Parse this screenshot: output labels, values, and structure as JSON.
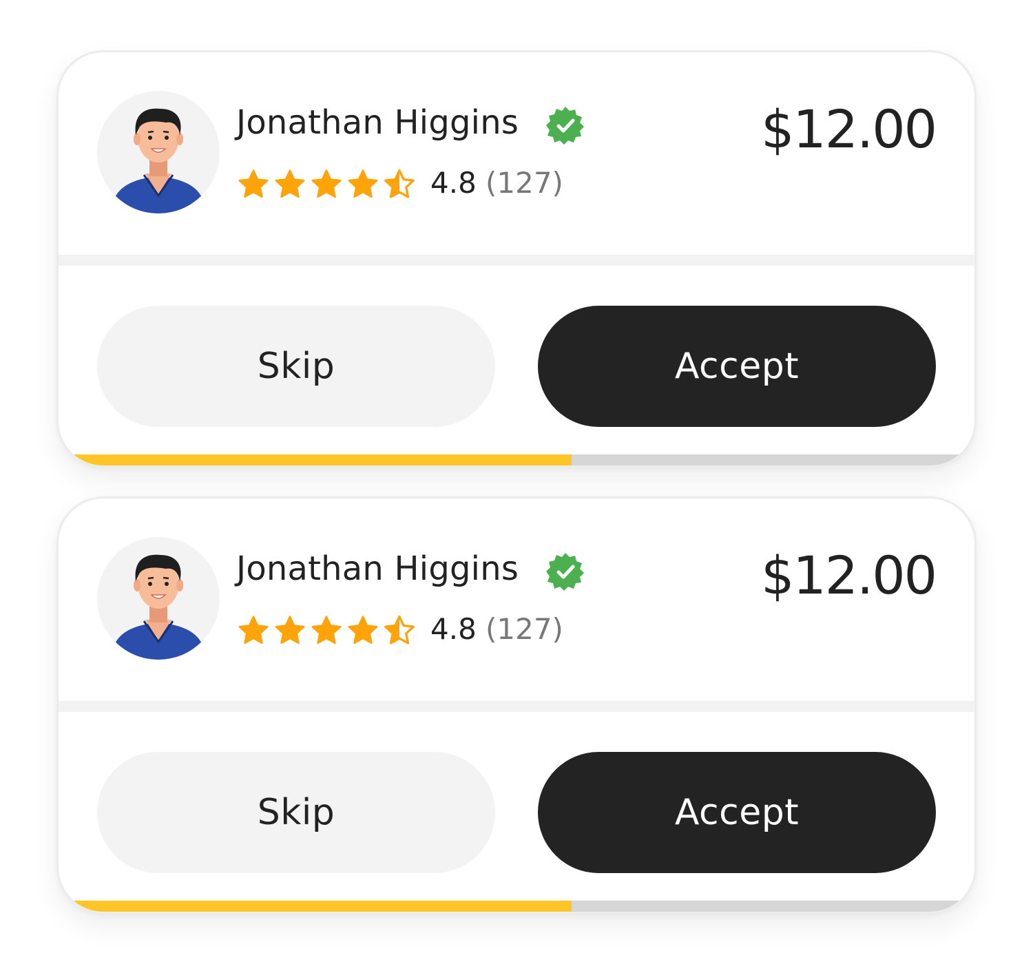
{
  "colors": {
    "accent_yellow": "#fdc526",
    "star_orange": "#fea30a",
    "verified_green": "#4caf50",
    "accept_bg": "#232323",
    "skip_bg": "#f3f3f3",
    "track_grey": "#d6d6d6",
    "shirt_blue": "#2b4ead"
  },
  "cards": [
    {
      "name": "Jonathan Higgins",
      "verified_icon": "verified-badge-icon",
      "stars": [
        "full",
        "full",
        "full",
        "full",
        "half"
      ],
      "rating": "4.8",
      "reviews": "(127)",
      "price": "$12.00",
      "skip_label": "Skip",
      "accept_label": "Accept",
      "progress_fraction": 0.56
    },
    {
      "name": "Jonathan Higgins",
      "verified_icon": "verified-badge-icon",
      "stars": [
        "full",
        "full",
        "full",
        "full",
        "half"
      ],
      "rating": "4.8",
      "reviews": "(127)",
      "price": "$12.00",
      "skip_label": "Skip",
      "accept_label": "Accept",
      "progress_fraction": 0.56
    }
  ]
}
